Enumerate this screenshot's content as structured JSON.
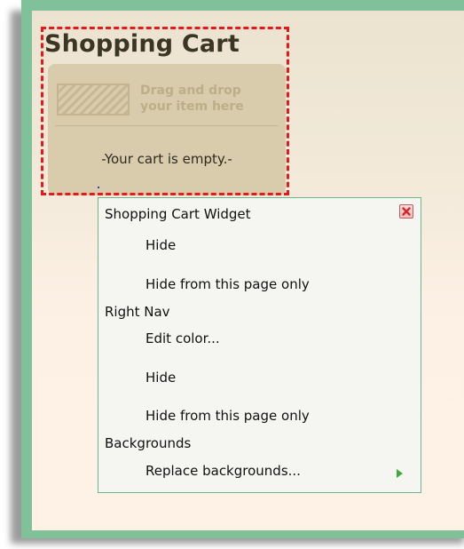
{
  "cart": {
    "title": "Shopping Cart",
    "drop_line1": "Drag and drop",
    "drop_line2": "your item here",
    "empty_message": "-Your cart is empty.-"
  },
  "context_menu": {
    "sections": [
      {
        "heading": "Shopping Cart Widget",
        "items": [
          "Hide",
          "Hide from this page only"
        ]
      },
      {
        "heading": "Right Nav",
        "items": [
          "Edit color...",
          "Hide",
          "Hide from this page only"
        ]
      },
      {
        "heading": "Backgrounds",
        "items": [
          "Replace backgrounds..."
        ]
      }
    ]
  },
  "icons": {
    "close": "close-icon",
    "submenu": "submenu-arrow-icon",
    "drop_target": "drop-target-icon"
  },
  "colors": {
    "frame": "#80c19a",
    "selection_outline": "#e21a1a",
    "cart_panel": "#d8ccac",
    "menu_border": "#6fb58a",
    "submenu_arrow": "#3faa3f",
    "close_icon": "#cc2a2a"
  }
}
